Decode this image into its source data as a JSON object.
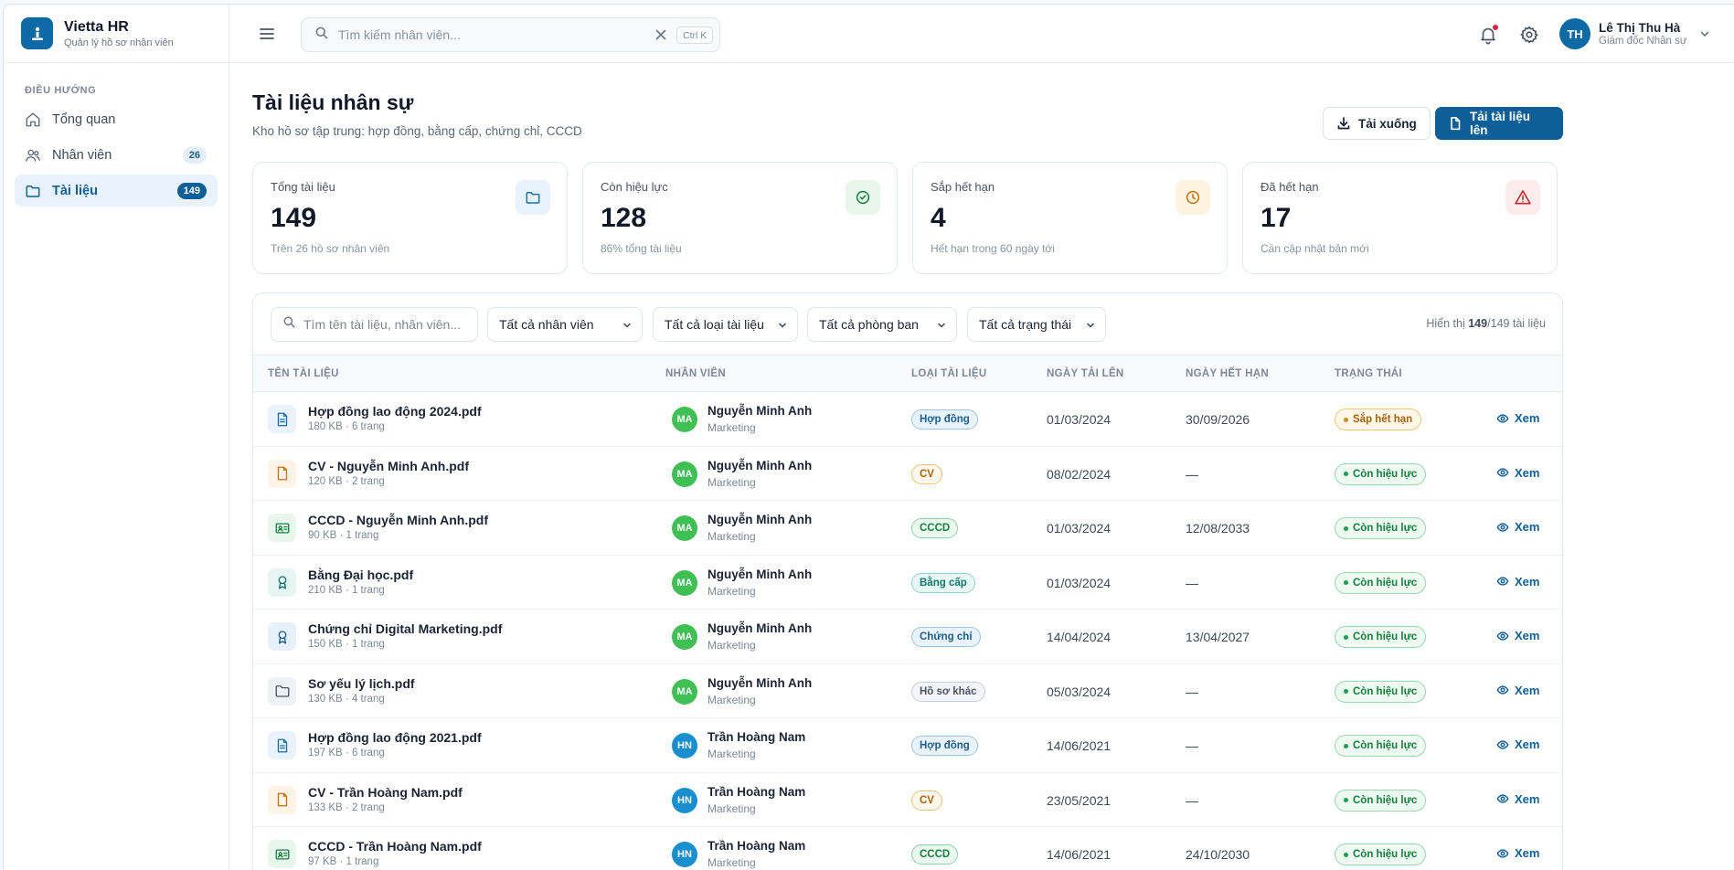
{
  "app": {
    "name": "Vietta HR",
    "subtitle": "Quản lý hồ sơ nhân viên"
  },
  "sidebar": {
    "section": "ĐIỀU HƯỚNG",
    "items": [
      {
        "label": "Tổng quan",
        "icon": "home-icon",
        "badge": ""
      },
      {
        "label": "Nhân viên",
        "icon": "users-icon",
        "badge": "26"
      },
      {
        "label": "Tài liệu",
        "icon": "folder-icon",
        "badge": "149",
        "active": true
      }
    ]
  },
  "topbar": {
    "search_placeholder": "Tìm kiếm nhân viên...",
    "shortcut": "Ctrl K",
    "user": {
      "initials": "TH",
      "name": "Lê Thị Thu Hà",
      "role": "Giám đốc Nhân sự"
    }
  },
  "page": {
    "title": "Tài liệu nhân sự",
    "subtitle": "Kho hồ sơ tập trung: hợp đồng, bằng cấp, chứng chỉ, CCCD",
    "download_label": "Tải xuống",
    "upload_label": "Tải tài liệu lên"
  },
  "stats": [
    {
      "label": "Tổng tài liệu",
      "value": "149",
      "foot": "Trên 26 hồ sơ nhân viên",
      "icon": "folder-icon",
      "color": "#1b6fa8",
      "bg": "#e8f2fa"
    },
    {
      "label": "Còn hiệu lực",
      "value": "128",
      "foot": "86% tổng tài liệu",
      "icon": "check-circle-icon",
      "color": "#15803d",
      "bg": "#e7f6ec"
    },
    {
      "label": "Sắp hết hạn",
      "value": "4",
      "foot": "Hết hạn trong 60 ngày tới",
      "icon": "clock-icon",
      "color": "#c2730c",
      "bg": "#fdf3e1"
    },
    {
      "label": "Đã hết hạn",
      "value": "17",
      "foot": "Cần cập nhật bản mới",
      "icon": "alert-triangle-icon",
      "color": "#c62828",
      "bg": "#fdecec"
    }
  ],
  "filters": {
    "search_placeholder": "Tìm tên tài liệu, nhân viên...",
    "employee": "Tất cả nhân viên",
    "doc_type": "Tất cả loại tài liệu",
    "department": "Tất cả phòng ban",
    "status": "Tất cả trạng thái",
    "count_prefix": "Hiển thị ",
    "count_shown": "149",
    "count_suffix": "/149 tài liệu"
  },
  "table": {
    "headers": {
      "name": "TÊN TÀI LIỆU",
      "employee": "NHÂN VIÊN",
      "type": "LOẠI TÀI LIỆU",
      "uploaded": "NGÀY TẢI LÊN",
      "expires": "NGÀY HẾT HẠN",
      "status": "TRẠNG THÁI"
    },
    "view_label": "Xem",
    "rows": [
      {
        "name": "Hợp đồng lao động 2024.pdf",
        "meta": "180 KB · 6 trang",
        "icon": "contract-icon",
        "emp_initials": "MA",
        "emp_name": "Nguyễn Minh Anh",
        "dept": "Marketing",
        "type": "Hợp đồng",
        "uploaded": "01/03/2024",
        "expires": "30/09/2026",
        "status": "Sắp hết hạn"
      },
      {
        "name": "CV - Nguyễn Minh Anh.pdf",
        "meta": "120 KB · 2 trang",
        "icon": "cv-icon",
        "emp_initials": "MA",
        "emp_name": "Nguyễn Minh Anh",
        "dept": "Marketing",
        "type": "CV",
        "uploaded": "08/02/2024",
        "expires": "—",
        "status": "Còn hiệu lực"
      },
      {
        "name": "CCCD - Nguyễn Minh Anh.pdf",
        "meta": "90 KB · 1 trang",
        "icon": "id-card-icon",
        "emp_initials": "MA",
        "emp_name": "Nguyễn Minh Anh",
        "dept": "Marketing",
        "type": "CCCD",
        "uploaded": "01/03/2024",
        "expires": "12/08/2033",
        "status": "Còn hiệu lực"
      },
      {
        "name": "Bằng Đại học.pdf",
        "meta": "210 KB · 1 trang",
        "icon": "award-icon",
        "emp_initials": "MA",
        "emp_name": "Nguyễn Minh Anh",
        "dept": "Marketing",
        "type": "Bằng cấp",
        "uploaded": "01/03/2024",
        "expires": "—",
        "status": "Còn hiệu lực"
      },
      {
        "name": "Chứng chỉ Digital Marketing.pdf",
        "meta": "150 KB · 1 trang",
        "icon": "certificate-icon",
        "emp_initials": "MA",
        "emp_name": "Nguyễn Minh Anh",
        "dept": "Marketing",
        "type": "Chứng chỉ",
        "uploaded": "14/04/2024",
        "expires": "13/04/2027",
        "status": "Còn hiệu lực"
      },
      {
        "name": "Sơ yếu lý lịch.pdf",
        "meta": "130 KB · 4 trang",
        "icon": "folder-icon",
        "emp_initials": "MA",
        "emp_name": "Nguyễn Minh Anh",
        "dept": "Marketing",
        "type": "Hồ sơ khác",
        "uploaded": "05/03/2024",
        "expires": "—",
        "status": "Còn hiệu lực"
      },
      {
        "name": "Hợp đồng lao động 2021.pdf",
        "meta": "197 KB · 6 trang",
        "icon": "contract-icon",
        "emp_initials": "HN",
        "emp_name": "Trần Hoàng Nam",
        "dept": "Marketing",
        "type": "Hợp đồng",
        "uploaded": "14/06/2021",
        "expires": "—",
        "status": "Còn hiệu lực"
      },
      {
        "name": "CV - Trần Hoàng Nam.pdf",
        "meta": "133 KB · 2 trang",
        "icon": "cv-icon",
        "emp_initials": "HN",
        "emp_name": "Trần Hoàng Nam",
        "dept": "Marketing",
        "type": "CV",
        "uploaded": "23/05/2021",
        "expires": "—",
        "status": "Còn hiệu lực"
      },
      {
        "name": "CCCD - Trần Hoàng Nam.pdf",
        "meta": "97 KB · 1 trang",
        "icon": "id-card-icon",
        "emp_initials": "HN",
        "emp_name": "Trần Hoàng Nam",
        "dept": "Marketing",
        "type": "CCCD",
        "uploaded": "14/06/2021",
        "expires": "24/10/2030",
        "status": "Còn hiệu lực"
      }
    ]
  },
  "colors": {
    "primary": "#0e5f97",
    "avatar_ma": "#3fbf54",
    "avatar_hn": "#1a8fd0"
  }
}
